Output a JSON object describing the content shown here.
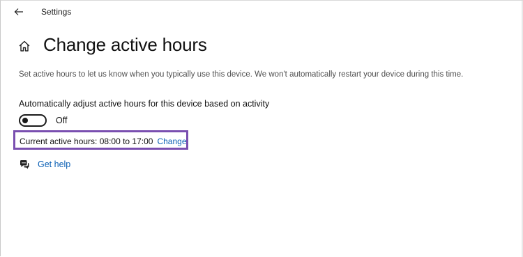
{
  "window": {
    "title": "Settings"
  },
  "page": {
    "title": "Change active hours",
    "description": "Set active hours to let us know when you typically use this device. We won't automatically restart your device during this time."
  },
  "auto_adjust": {
    "label": "Automatically adjust active hours for this device based on activity",
    "state": "Off"
  },
  "active_hours": {
    "text": "Current active hours: 08:00 to 17:00",
    "change_label": "Change"
  },
  "help": {
    "label": "Get help"
  },
  "icons": {
    "back": "back-arrow-icon",
    "home": "home-icon",
    "help": "chat-help-icon"
  },
  "colors": {
    "link": "#0a5fb4",
    "highlight": "#7a4fb0"
  }
}
